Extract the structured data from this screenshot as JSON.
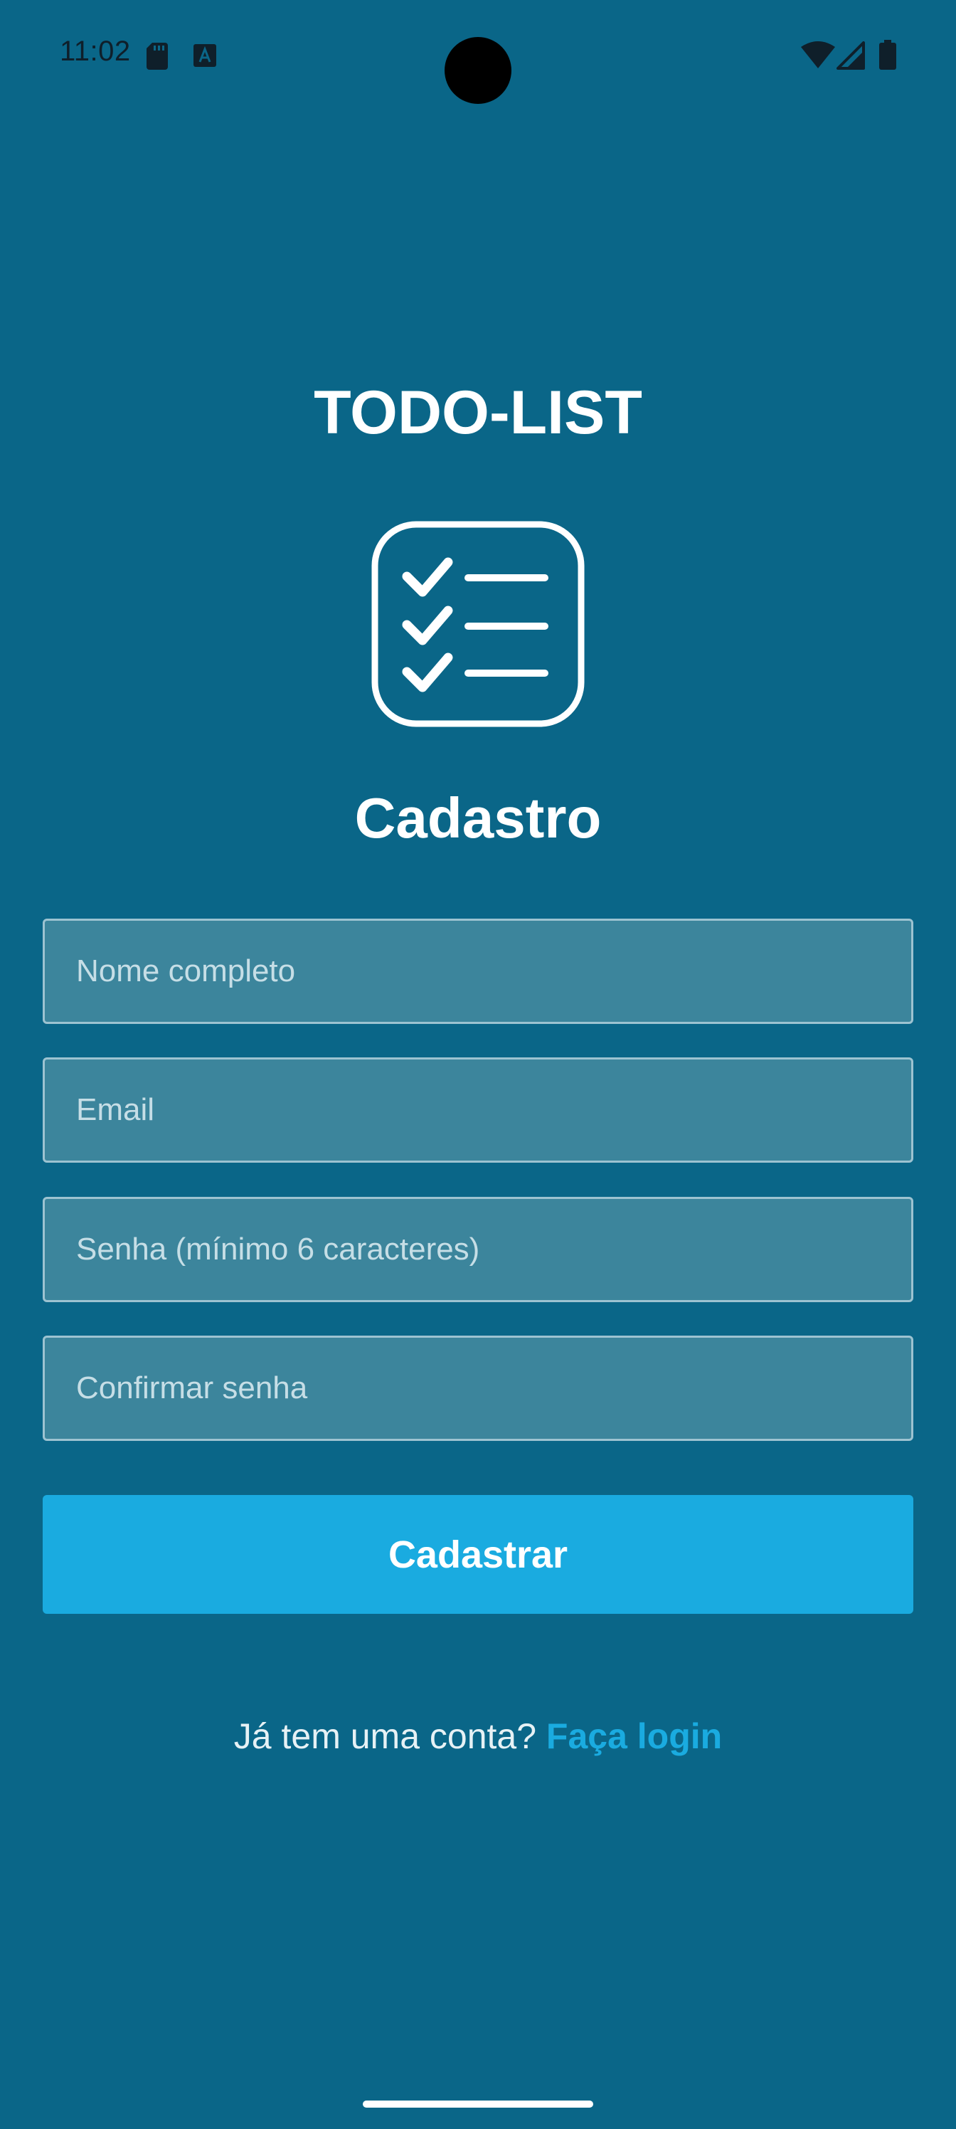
{
  "status_bar": {
    "time": "11:02",
    "icons": [
      "sd-card-icon",
      "a-notification-icon",
      "wifi-icon",
      "signal-icon",
      "battery-icon"
    ]
  },
  "app": {
    "title": "TODO-LIST",
    "logo_icon": "checklist-icon"
  },
  "form": {
    "title": "Cadastro",
    "fields": [
      {
        "name": "full-name",
        "placeholder": "Nome completo",
        "value": ""
      },
      {
        "name": "email",
        "placeholder": "Email",
        "value": ""
      },
      {
        "name": "password",
        "placeholder": "Senha (mínimo 6 caracteres)",
        "value": ""
      },
      {
        "name": "confirm-password",
        "placeholder": "Confirmar senha",
        "value": ""
      }
    ],
    "submit_label": "Cadastrar"
  },
  "login_prompt": {
    "text": "Já tem uma conta?",
    "link": "Faça login"
  },
  "colors": {
    "background": "#0a6688",
    "field_background": "#3c859c",
    "accent": "#1aabe0",
    "text": "#ffffff"
  }
}
